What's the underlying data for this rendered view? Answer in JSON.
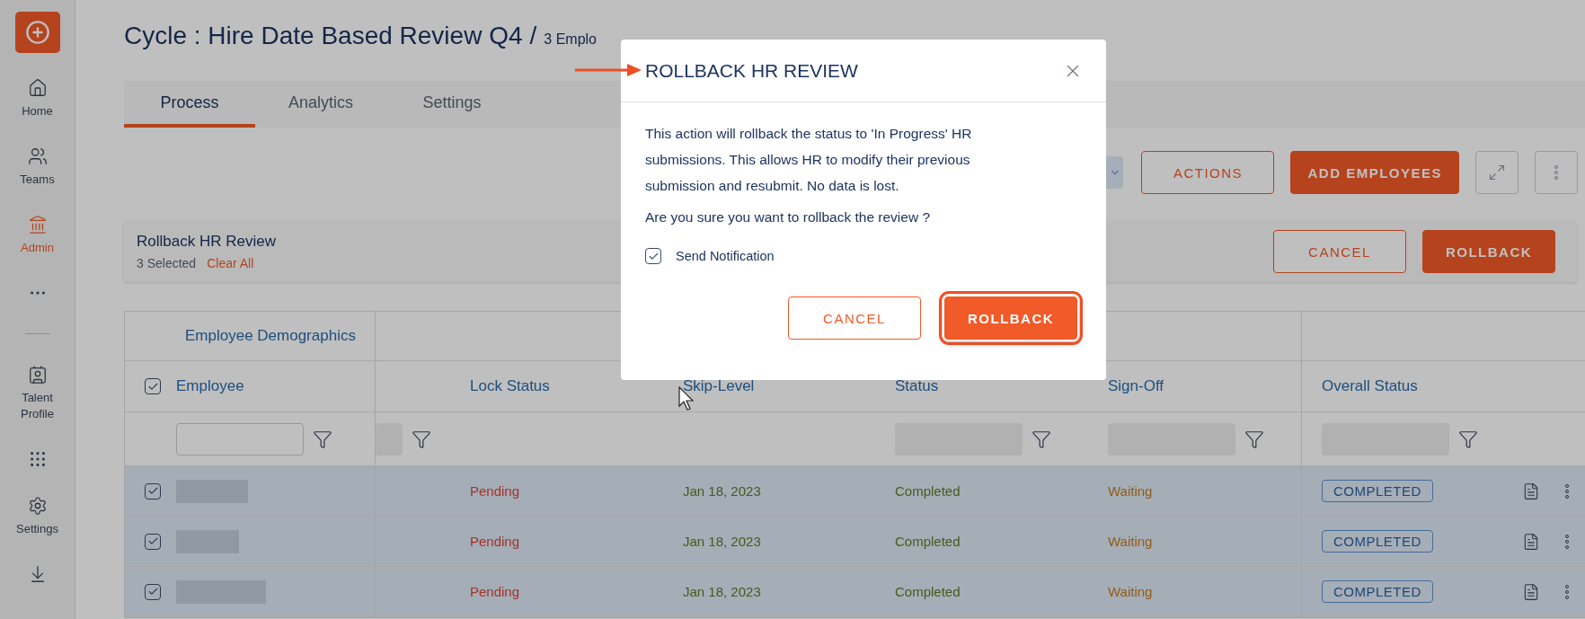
{
  "sidebar": {
    "items": [
      {
        "kind": "home",
        "label": "Home",
        "selected": false
      },
      {
        "kind": "teams",
        "label": "Teams",
        "selected": false
      },
      {
        "kind": "admin",
        "label": "Admin",
        "selected": true
      },
      {
        "kind": "more",
        "selected": false
      },
      {
        "kind": "divider"
      },
      {
        "kind": "profile",
        "label": "Talent Profile",
        "selected": false
      },
      {
        "kind": "apps",
        "selected": false
      },
      {
        "kind": "settings",
        "label": "Settings",
        "selected": false
      },
      {
        "kind": "download",
        "selected": false
      }
    ]
  },
  "header": {
    "title": "Cycle : Hire Date Based Review Q4",
    "separator": "/",
    "employees": "3 Emplo"
  },
  "tabs": [
    {
      "label": "Process",
      "selected": true
    },
    {
      "label": "Analytics",
      "selected": false
    },
    {
      "label": "Settings",
      "selected": false
    }
  ],
  "toolbar": {
    "buttons": [
      {
        "kind": "outline",
        "label": "ACTIONS"
      },
      {
        "kind": "filled",
        "label": "ADD EMPLOYEES"
      }
    ]
  },
  "selection_bar": {
    "title": "Rollback HR Review",
    "count": "3 Selected",
    "clear": "Clear All",
    "buttons": [
      {
        "kind": "outline",
        "label": "CANCEL"
      },
      {
        "kind": "filled",
        "label": "ROLLBACK"
      }
    ]
  },
  "table": {
    "group_header": "Employee Demographics",
    "select_all_checked": true,
    "columns": [
      "Employee",
      "Lock Status",
      "Skip-Level",
      "Status",
      "Sign-Off",
      "Overall Status"
    ],
    "rows": [
      {
        "selected": true,
        "lock_status": "Pending",
        "skip_level": "Jan 18, 2023",
        "status": "Completed",
        "sign_off": "Waiting",
        "overall_status": "COMPLETED"
      },
      {
        "selected": true,
        "lock_status": "Pending",
        "skip_level": "Jan 18, 2023",
        "status": "Completed",
        "sign_off": "Waiting",
        "overall_status": "COMPLETED"
      },
      {
        "selected": true,
        "lock_status": "Pending",
        "skip_level": "Jan 18, 2023",
        "status": "Completed",
        "sign_off": "Waiting",
        "overall_status": "COMPLETED"
      }
    ]
  },
  "dialog": {
    "title": "ROLLBACK HR REVIEW",
    "body": "This action will rollback the status to 'In Progress' HR submissions. This allows HR to modify their previous submission and resubmit. No data is lost.",
    "question": "Are you sure you want to rollback the review ?",
    "checkbox": {
      "label": "Send Notification",
      "checked": true
    },
    "buttons": [
      {
        "kind": "outline",
        "label": "CANCEL",
        "highlighted": false
      },
      {
        "kind": "filled",
        "label": "ROLLBACK",
        "highlighted": true
      }
    ]
  }
}
